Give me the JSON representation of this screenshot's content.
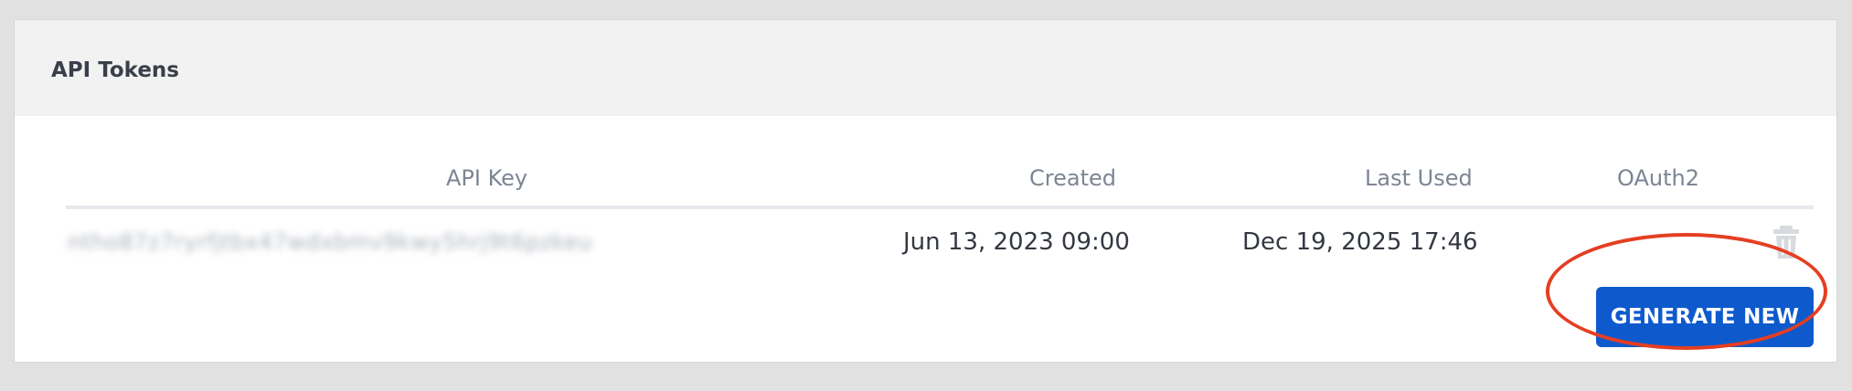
{
  "panel": {
    "title": "API Tokens"
  },
  "table": {
    "columns": [
      "API Key",
      "Created",
      "Last Used",
      "OAuth2"
    ],
    "rows": [
      {
        "api_key": "ntho87z7ryrfjtbx47wdxbmv9kwy5hrj9t6pzkeu",
        "created": "Jun 13, 2023 09:00",
        "last_used": "Dec 19, 2025 17:46",
        "oauth2": ""
      }
    ]
  },
  "actions": {
    "generate_label": "GENERATE NEW",
    "delete_icon": "trash-icon"
  },
  "colors": {
    "accent": "#0e5acd",
    "annotation": "#e53e22"
  }
}
